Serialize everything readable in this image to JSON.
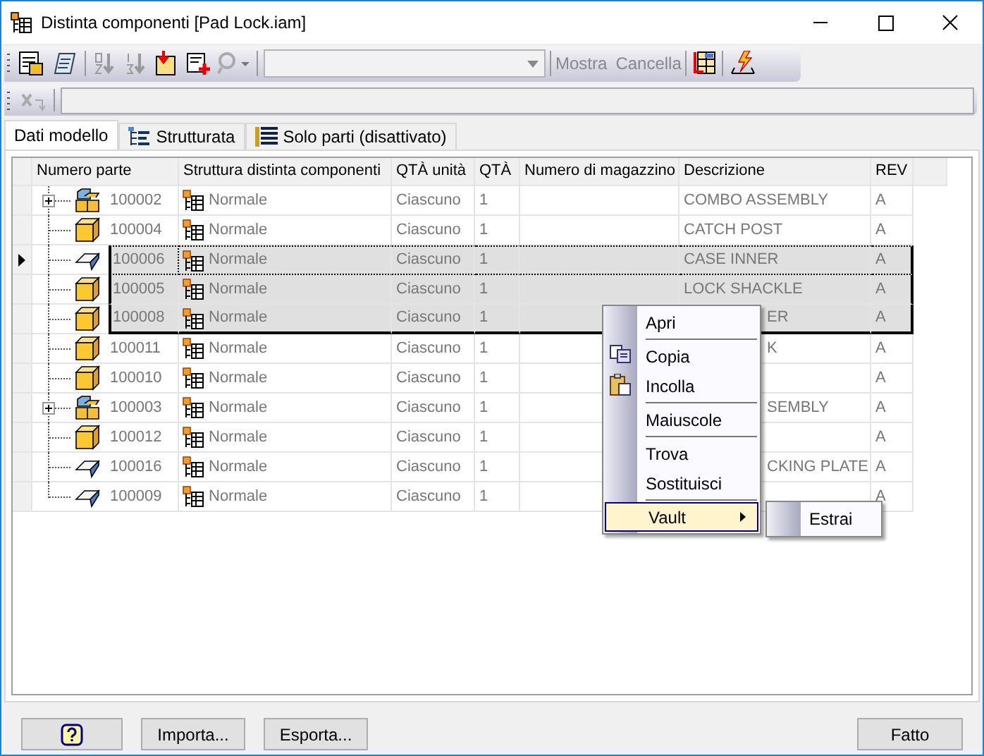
{
  "window": {
    "title": "Distinta componenti [Pad Lock.iam]"
  },
  "toolbar": {
    "buttons": [
      "Mostra",
      "Cancella"
    ]
  },
  "tabs": [
    {
      "label": "Dati modello",
      "selected": true,
      "kind": "plain"
    },
    {
      "label": "Strutturata",
      "selected": false,
      "kind": "tree"
    },
    {
      "label": "Solo parti (disattivato)",
      "selected": false,
      "kind": "list"
    }
  ],
  "table": {
    "columns": [
      "Numero parte",
      "Struttura distinta componenti",
      "QTÀ unità",
      "QTÀ",
      "Numero di magazzino",
      "Descrizione",
      "REV"
    ],
    "rows": [
      {
        "kind": "assembly",
        "expandable": true,
        "part": "100002",
        "structure": "Normale",
        "unit": "Ciascuno",
        "qty": "1",
        "description": "COMBO ASSEMBLY",
        "rev": "A",
        "selected": false,
        "current": false,
        "covered": false
      },
      {
        "kind": "part",
        "expandable": false,
        "part": "100004",
        "structure": "Normale",
        "unit": "Ciascuno",
        "qty": "1",
        "description": "CATCH POST",
        "rev": "A",
        "selected": false,
        "current": false,
        "covered": false
      },
      {
        "kind": "sheet",
        "expandable": false,
        "part": "100006",
        "structure": "Normale",
        "unit": "Ciascuno",
        "qty": "1",
        "description": "CASE INNER",
        "rev": "A",
        "selected": true,
        "current": true,
        "covered": false
      },
      {
        "kind": "part",
        "expandable": false,
        "part": "100005",
        "structure": "Normale",
        "unit": "Ciascuno",
        "qty": "1",
        "description": "LOCK SHACKLE",
        "rev": "A",
        "selected": true,
        "current": false,
        "covered": false
      },
      {
        "kind": "part",
        "expandable": false,
        "part": "100008",
        "structure": "Normale",
        "unit": "Ciascuno",
        "qty": "1",
        "description": "ER",
        "rev": "A",
        "selected": true,
        "current": false,
        "covered": true
      },
      {
        "kind": "part",
        "expandable": false,
        "part": "100011",
        "structure": "Normale",
        "unit": "Ciascuno",
        "qty": "1",
        "description": "K",
        "rev": "A",
        "selected": false,
        "current": false,
        "covered": true
      },
      {
        "kind": "part",
        "expandable": false,
        "part": "100010",
        "structure": "Normale",
        "unit": "Ciascuno",
        "qty": "1",
        "rev": "A",
        "selected": false,
        "current": false
      },
      {
        "kind": "assembly",
        "expandable": true,
        "part": "100003",
        "structure": "Normale",
        "unit": "Ciascuno",
        "qty": "1",
        "description": "SEMBLY",
        "rev": "A",
        "selected": false,
        "current": false,
        "covered": true
      },
      {
        "kind": "part",
        "expandable": false,
        "part": "100012",
        "structure": "Normale",
        "unit": "Ciascuno",
        "qty": "1",
        "rev": "A",
        "selected": false,
        "current": false
      },
      {
        "kind": "sheet",
        "expandable": false,
        "part": "100016",
        "structure": "Normale",
        "unit": "Ciascuno",
        "qty": "1",
        "description": "CKING PLATE",
        "rev": "A",
        "selected": false,
        "current": false,
        "covered": true
      },
      {
        "kind": "sheet",
        "expandable": false,
        "part": "100009",
        "structure": "Normale",
        "unit": "Ciascuno",
        "qty": "1",
        "rev": "A",
        "selected": false,
        "current": false
      }
    ]
  },
  "context_menu": {
    "items": [
      {
        "kind": "plain",
        "label": "Apri",
        "separator_after": true
      },
      {
        "kind": "copy",
        "label": "Copia",
        "separator_after": false
      },
      {
        "kind": "paste",
        "label": "Incolla",
        "separator_after": true
      },
      {
        "kind": "plain",
        "label": "Maiuscole",
        "separator_after": true
      },
      {
        "kind": "plain",
        "label": "Trova",
        "separator_after": false
      },
      {
        "kind": "plain",
        "label": "Sostituisci",
        "separator_after": true
      },
      {
        "kind": "submenu",
        "label": "Vault",
        "separator_after": false,
        "selected": true,
        "children": [
          {
            "label": "Estrai"
          }
        ]
      }
    ]
  },
  "buttons": [
    {
      "kind": "help"
    },
    {
      "kind": "text",
      "label": "Importa..."
    },
    {
      "kind": "text",
      "label": "Esporta..."
    },
    {
      "kind": "text",
      "label": "Fatto"
    }
  ]
}
